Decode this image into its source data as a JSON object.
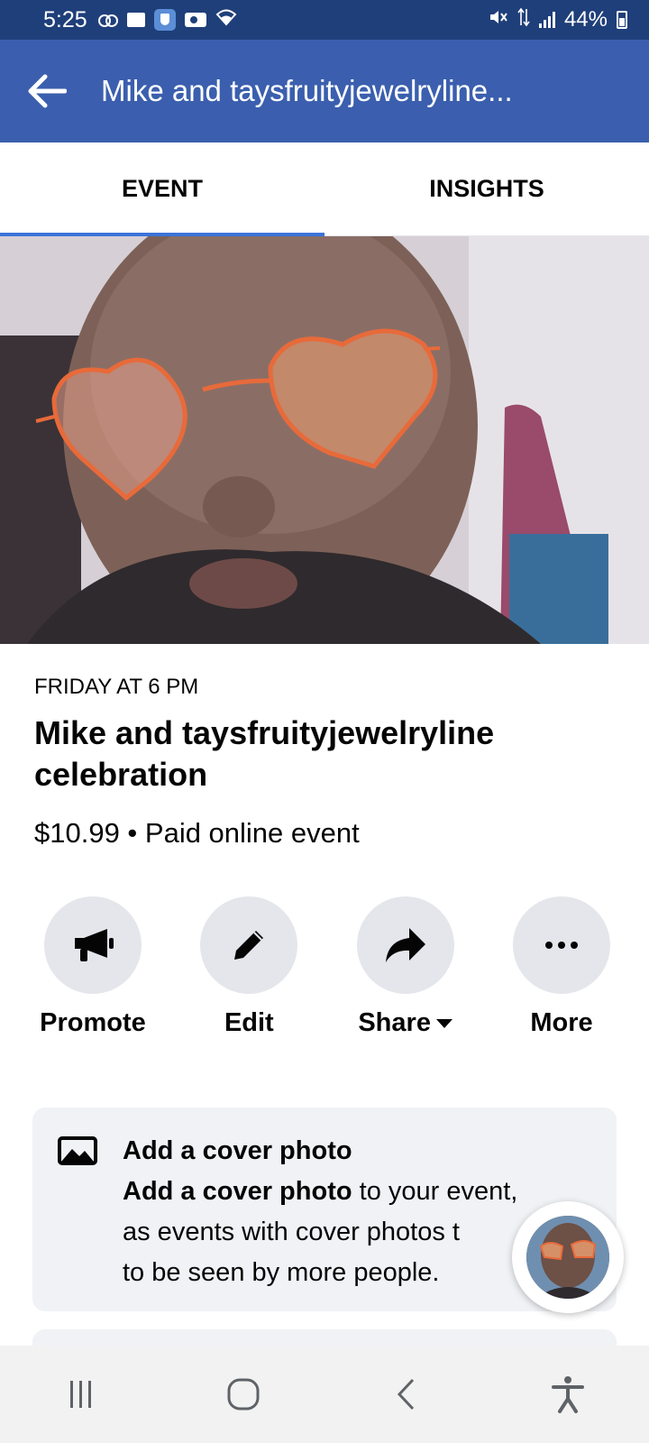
{
  "status_bar": {
    "time": "5:25",
    "battery": "44%",
    "icons": [
      "voicemail-icon",
      "folder-icon",
      "shield-icon",
      "video-icon",
      "wifi-icon",
      "mute-icon",
      "data-icon",
      "signal-icon",
      "battery-icon"
    ]
  },
  "header": {
    "title": "Mike and taysfruityjewelryline...",
    "back_icon": "arrow-left-icon",
    "color": "#3b5fae"
  },
  "tabs": [
    {
      "label": "EVENT",
      "active": true
    },
    {
      "label": "INSIGHTS",
      "active": false
    }
  ],
  "event": {
    "date": "FRIDAY AT 6 PM",
    "title": "Mike and taysfruityjewelryline celebration",
    "meta": "$10.99 • Paid online event"
  },
  "actions": [
    {
      "label": "Promote",
      "icon": "megaphone-icon"
    },
    {
      "label": "Edit",
      "icon": "pencil-icon"
    },
    {
      "label": "Share",
      "icon": "share-arrow-icon"
    },
    {
      "label": "More",
      "icon": "more-dots-icon"
    }
  ],
  "cover_card": {
    "heading": "Add a cover photo",
    "body_bold": "Add a cover photo",
    "body_line1_rest": " to your event,",
    "body_line2": "as events with cover photos t",
    "body_line3": "to be seen by more people.",
    "icon": "image-icon"
  },
  "nav_bar": {
    "buttons": [
      "recent-apps-icon",
      "home-icon",
      "back-icon",
      "accessibility-icon"
    ]
  },
  "colors": {
    "status_bar": "#1f3f7a",
    "header": "#3b5fae",
    "tab_indicator": "#3b73d9",
    "button_bg": "#e4e6eb",
    "card_bg": "#f0f2f5"
  }
}
